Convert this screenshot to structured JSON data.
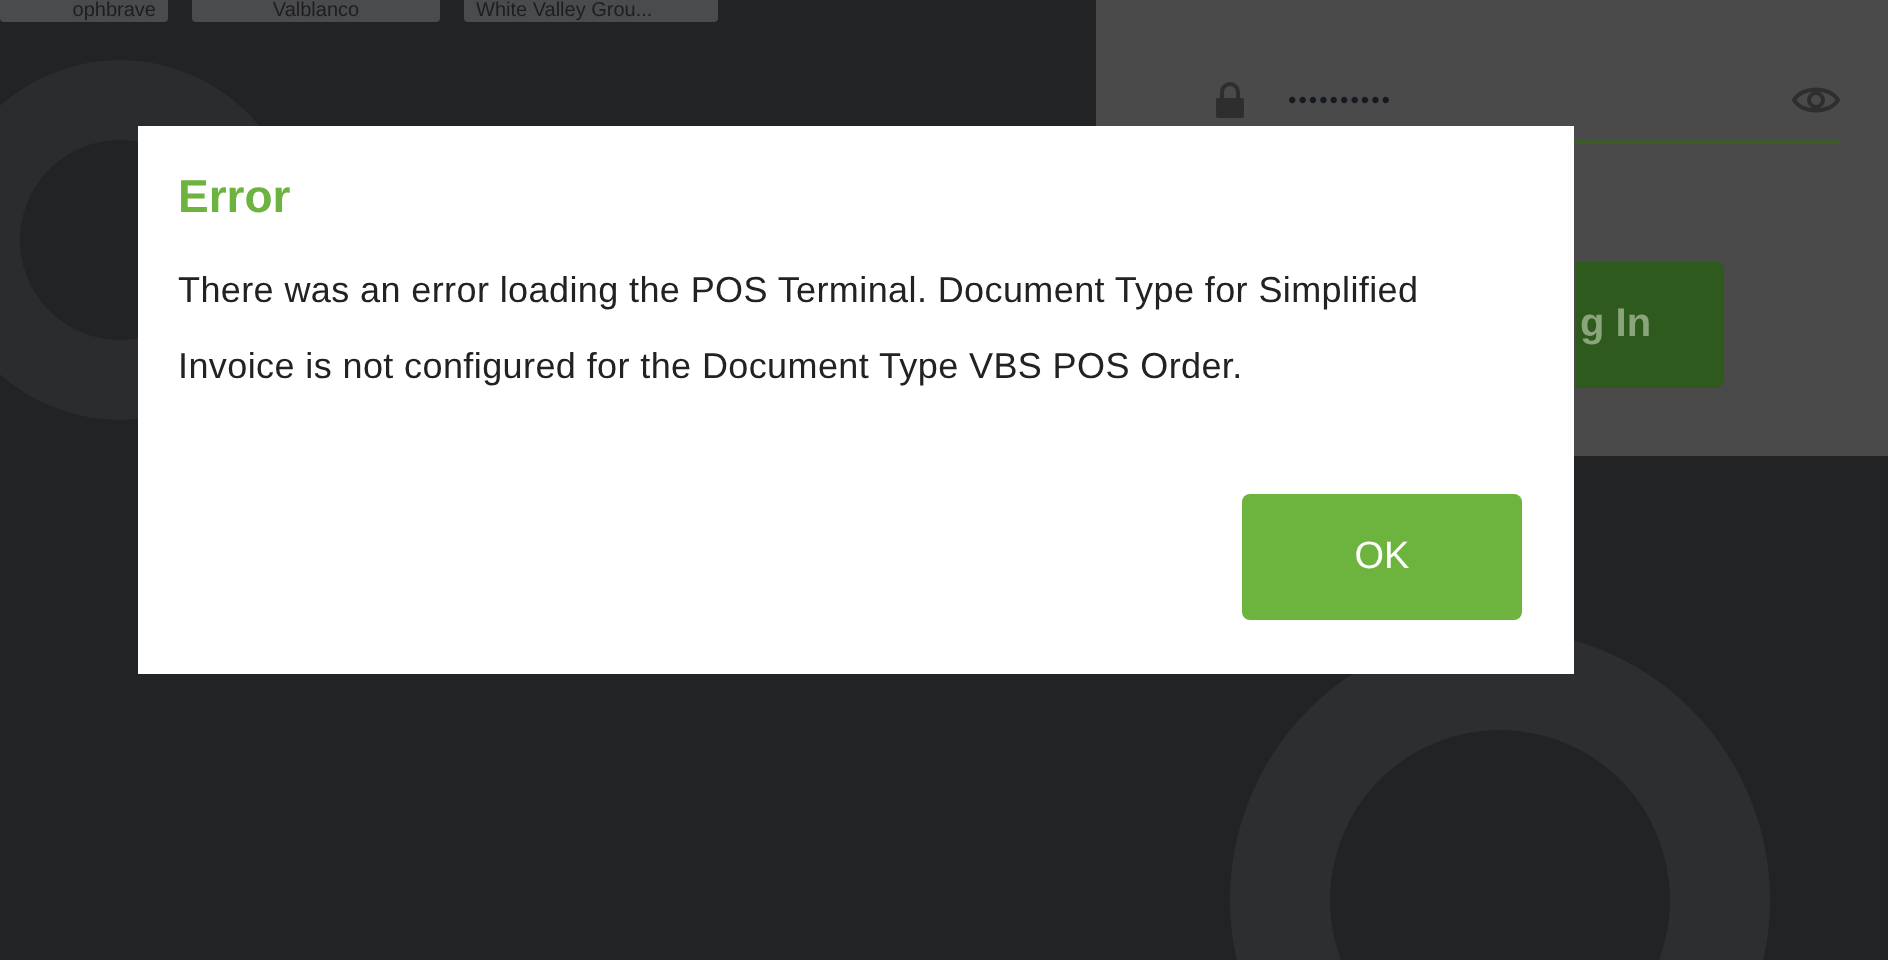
{
  "background": {
    "chips": [
      "ophbrave",
      "Valblanco",
      "White Valley Grou..."
    ],
    "login": {
      "password_mask": "••••••••••",
      "button": "g In"
    }
  },
  "dialog": {
    "title": "Error",
    "message": "There was an error loading the POS Terminal. Document Type for Simplified Invoice is not configured for the Document Type VBS POS Order.",
    "buttons": [
      "OK"
    ]
  }
}
